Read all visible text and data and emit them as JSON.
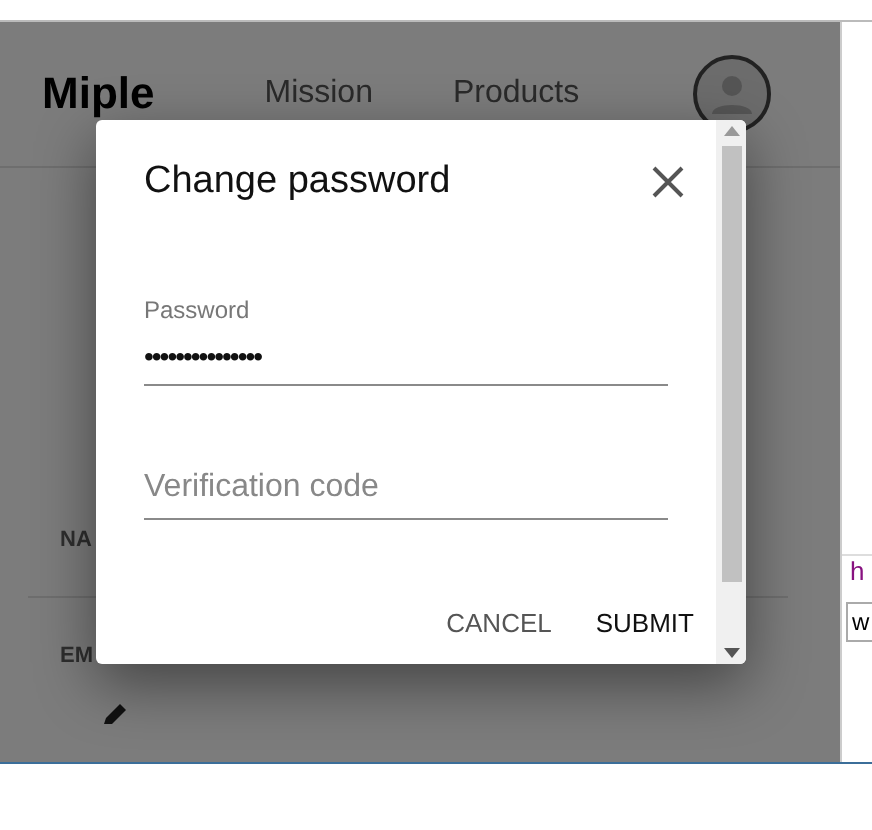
{
  "header": {
    "brand": "Miple",
    "nav": [
      {
        "label": "Mission"
      },
      {
        "label": "Products"
      }
    ]
  },
  "background_rows": [
    {
      "label": "NA"
    },
    {
      "label": "EM"
    }
  ],
  "dialog": {
    "title": "Change password",
    "fields": [
      {
        "label": "Password",
        "value": "•••••••••••••••"
      },
      {
        "placeholder": "Verification code"
      }
    ],
    "buttons": [
      {
        "label": "CANCEL",
        "primary": false
      },
      {
        "label": "SUBMIT",
        "primary": true
      }
    ]
  },
  "side_panel": {
    "link": "h",
    "input_value": "w"
  }
}
